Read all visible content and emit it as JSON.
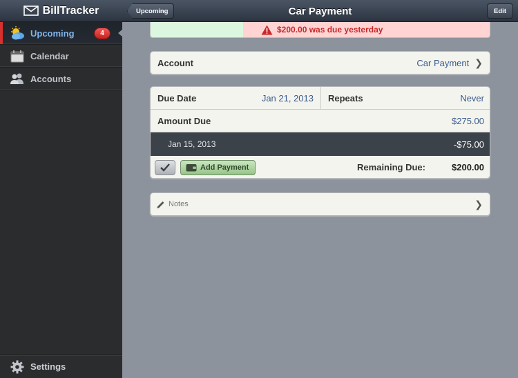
{
  "sidebar": {
    "app_title": "BillTracker",
    "items": [
      {
        "label": "Upcoming",
        "icon": "weather-icon",
        "badge": "4",
        "active": true
      },
      {
        "label": "Calendar",
        "icon": "calendar-icon"
      },
      {
        "label": "Accounts",
        "icon": "users-icon"
      }
    ],
    "settings_label": "Settings"
  },
  "navbar": {
    "title": "Car Payment",
    "back_label": "Upcoming",
    "edit_label": "Edit"
  },
  "alert": {
    "message": "$200.00 was due yesterday",
    "icon": "warning-icon"
  },
  "account": {
    "label": "Account",
    "value": "Car Payment"
  },
  "bill": {
    "due_date_label": "Due Date",
    "due_date_value": "Jan 21, 2013",
    "repeats_label": "Repeats",
    "repeats_value": "Never",
    "amount_due_label": "Amount Due",
    "amount_due_value": "$275.00",
    "payments": [
      {
        "date": "Jan 15, 2013",
        "amount": "-$75.00"
      }
    ],
    "add_payment_label": "Add Payment",
    "remaining_label": "Remaining Due:",
    "remaining_value": "$200.00"
  },
  "notes": {
    "label": "Notes"
  },
  "colors": {
    "accent_blue": "#3a5a8c",
    "alert_red": "#c8282a",
    "badge_red": "#d8302c",
    "paid_green": "#dcf7df"
  }
}
